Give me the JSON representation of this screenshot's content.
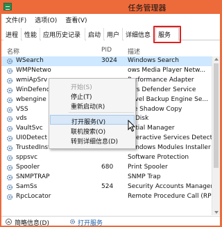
{
  "window": {
    "title": "任务管理器"
  },
  "menu": [
    "文件(F)",
    "选项(O)",
    "查看(V)"
  ],
  "tabs": [
    "进程",
    "性能",
    "应用历史记录",
    "启动",
    "用户",
    "详细信息",
    "服务"
  ],
  "active_tab": "服务",
  "columns": {
    "name": "名称",
    "pid": "PID",
    "desc": "描述"
  },
  "rows": [
    {
      "name": "WSearch",
      "pid": "3024",
      "desc": "Windows Search"
    },
    {
      "name": "WMPNetwo",
      "pid": "",
      "desc": "ows Media Player Netw..."
    },
    {
      "name": "wmiApSrv",
      "pid": "",
      "desc": "Performance Adapter"
    },
    {
      "name": "WinDefend",
      "pid": "",
      "desc": "ows Defender Service"
    },
    {
      "name": "wbengine",
      "pid": "",
      "desc": "Level Backup Engine Se..."
    },
    {
      "name": "VSS",
      "pid": "",
      "desc": "me Shadow Copy"
    },
    {
      "name": "vds",
      "pid": "",
      "desc": "al Disk"
    },
    {
      "name": "VaultSvc",
      "pid": "",
      "desc": "ential Manager"
    },
    {
      "name": "UI0Detect",
      "pid": "",
      "desc": "Interactive Services Detection"
    },
    {
      "name": "TrustedInstaller",
      "pid": "",
      "desc": "Windows Modules Installer"
    },
    {
      "name": "sppsvc",
      "pid": "",
      "desc": "Software Protection"
    },
    {
      "name": "Spooler",
      "pid": "680",
      "desc": "Print Spooler"
    },
    {
      "name": "SNMPTRAP",
      "pid": "",
      "desc": "SNMP Trap"
    },
    {
      "name": "SamSs",
      "pid": "524",
      "desc": "Security Accounts Manager"
    },
    {
      "name": "RpcLocator",
      "pid": "",
      "desc": "Remote Procedure Call (RPC) ..."
    },
    {
      "name": "",
      "pid": "",
      "desc": ""
    }
  ],
  "context_menu": {
    "start": "开始(S)",
    "stop": "停止(T)",
    "restart": "重新启动(R)",
    "open_services": "打开服务(V)",
    "search_online": "联机搜索(O)",
    "go_to_details": "转到详细信息(D)"
  },
  "status": {
    "fewer_details": "简略信息(D)",
    "open_services": "打开服务"
  },
  "colors": {
    "accent": "#ed6a3a",
    "selection": "#cde8ff",
    "highlight_box": "#e02020",
    "link": "#1b5fa8"
  }
}
